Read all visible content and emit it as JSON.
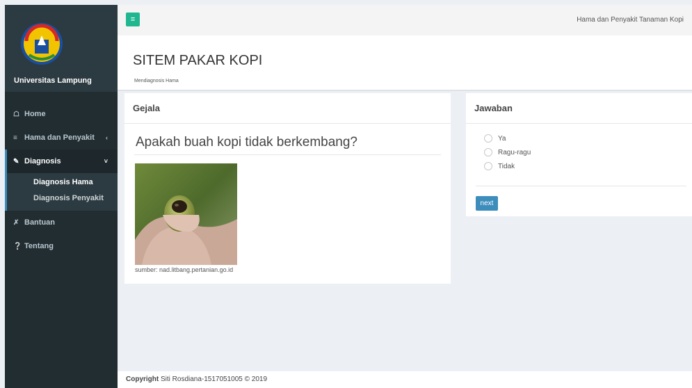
{
  "sidebar": {
    "brand_name": "Universitas Lampung",
    "menu": [
      {
        "icon": "home-icon",
        "label": "Home"
      },
      {
        "icon": "list-icon",
        "label": "Hama dan Penyakit"
      },
      {
        "icon": "edit-icon",
        "label": "Diagnosis"
      },
      {
        "icon": "wrench-icon",
        "label": "Bantuan"
      },
      {
        "icon": "info-icon",
        "label": "Tentang"
      }
    ],
    "submenu": [
      "Diagnosis Hama",
      "Diagnosis Penyakit"
    ]
  },
  "topbar": {
    "title": "Hama dan Penyakit Tanaman Kopi"
  },
  "header": {
    "title": "SITEM PAKAR KOPI",
    "subtitle": "Mendiagnosis Hama"
  },
  "gejala": {
    "heading": "Gejala",
    "question": "Apakah buah kopi tidak berkembang?",
    "caption": "sumber: nad.litbang.pertanian.go.id"
  },
  "jawaban": {
    "heading": "Jawaban",
    "options": [
      "Ya",
      "Ragu-ragu",
      "Tidak"
    ],
    "next_label": "next"
  },
  "footer": {
    "copyright_label": "Copyright",
    "copyright_text": " Siti Rosdiana-1517051005 © 2019"
  },
  "colors": {
    "sidebar_bg": "#222d32",
    "accent_green": "#20b690",
    "primary_blue": "#3c8dbc"
  }
}
